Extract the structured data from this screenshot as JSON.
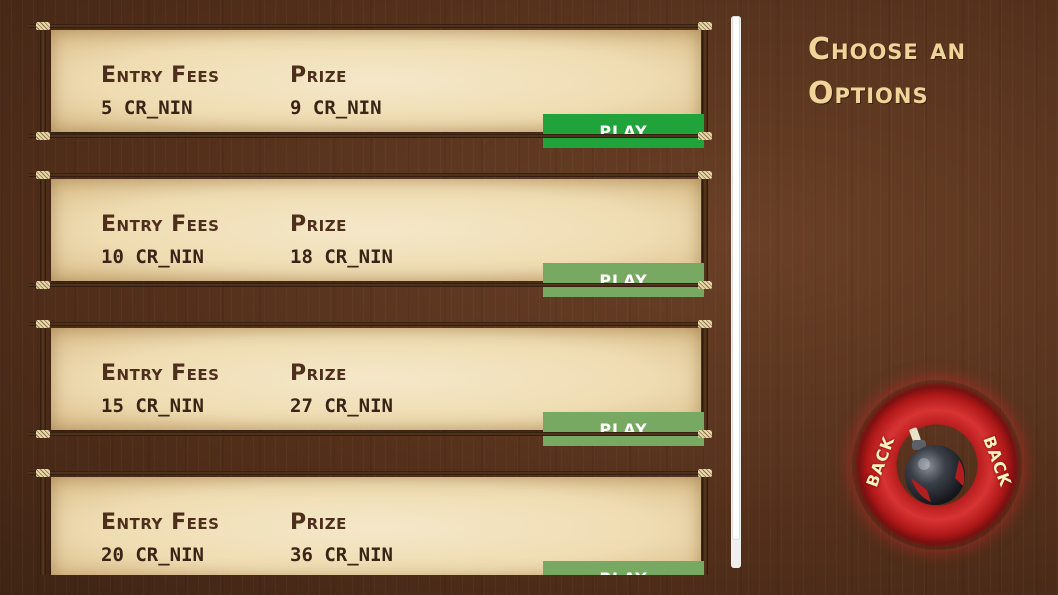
{
  "title": {
    "line1": "Choose an",
    "line2": "Options"
  },
  "back_button": {
    "label_left": "BACK",
    "label_right": "BACK",
    "icon": "bomb-icon"
  },
  "colors": {
    "play_active": "#1fa33a",
    "play_inactive": "#78a963",
    "title": "#f0d49a",
    "text": "#4e2f1c",
    "back_ring": "#c62626"
  },
  "options": [
    {
      "entry_label": "Entry Fees",
      "entry_value": "5 CR_NIN",
      "prize_label": "Prize",
      "prize_value": "9 CR_NIN",
      "play_label": "PLAY",
      "active": true
    },
    {
      "entry_label": "Entry Fees",
      "entry_value": "10 CR_NIN",
      "prize_label": "Prize",
      "prize_value": "18 CR_NIN",
      "play_label": "PLAY",
      "active": false
    },
    {
      "entry_label": "Entry Fees",
      "entry_value": "15 CR_NIN",
      "prize_label": "Prize",
      "prize_value": "27 CR_NIN",
      "play_label": "PLAY",
      "active": false
    },
    {
      "entry_label": "Entry Fees",
      "entry_value": "20 CR_NIN",
      "prize_label": "Prize",
      "prize_value": "36 CR_NIN",
      "play_label": "PLAY",
      "active": false
    }
  ]
}
